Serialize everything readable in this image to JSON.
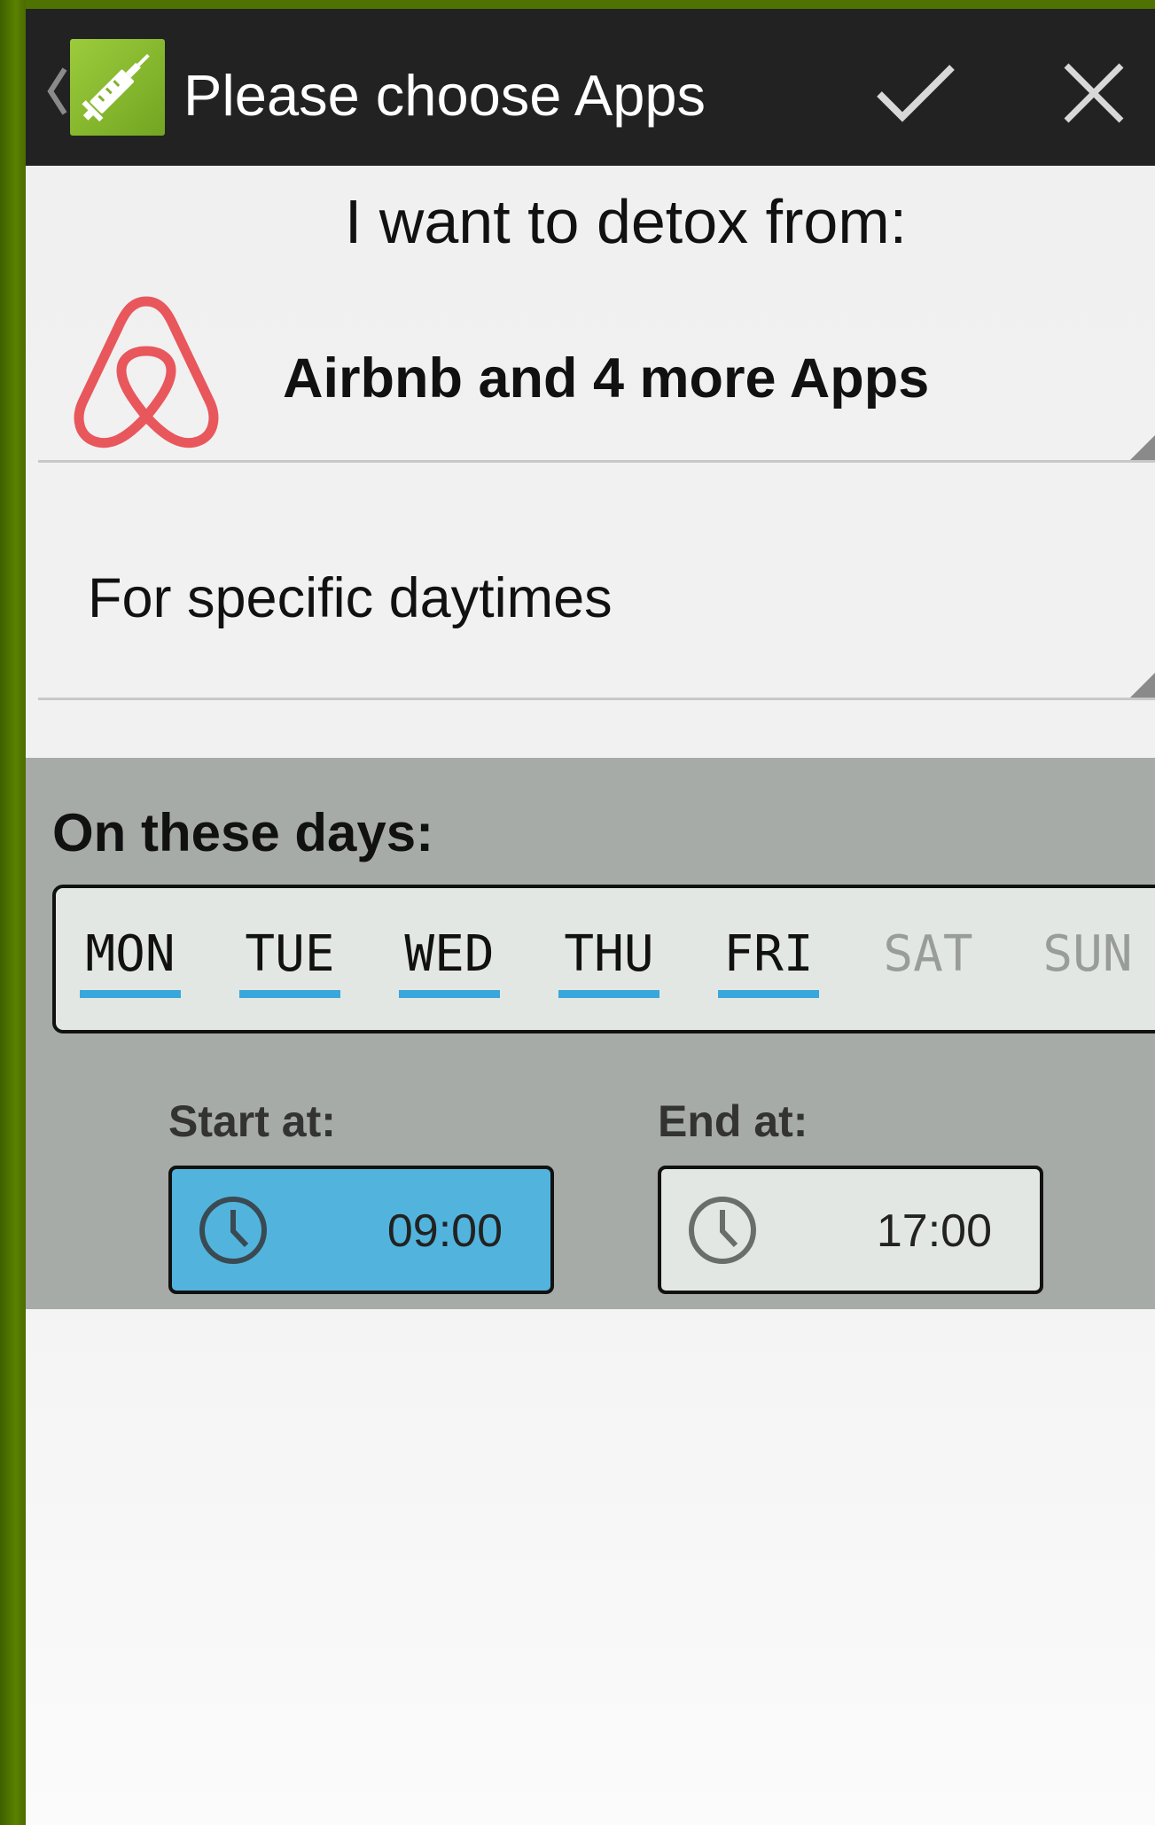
{
  "action_bar": {
    "title": "Please choose Apps",
    "icons": {
      "up": "back-caret-icon",
      "app": "syringe-icon",
      "confirm": "checkmark-icon",
      "cancel": "close-icon"
    }
  },
  "main": {
    "heading": "I want to detox from:",
    "app_selector": {
      "label": "Airbnb and 4 more Apps",
      "icon": "airbnb-logo"
    },
    "mode_selector": {
      "label": "For specific daytimes"
    }
  },
  "schedule": {
    "days_heading": "On these days:",
    "days": [
      {
        "label": "MON",
        "selected": true
      },
      {
        "label": "TUE",
        "selected": true
      },
      {
        "label": "WED",
        "selected": true
      },
      {
        "label": "THU",
        "selected": true
      },
      {
        "label": "FRI",
        "selected": true
      },
      {
        "label": "SAT",
        "selected": false
      },
      {
        "label": "SUN",
        "selected": false
      }
    ],
    "start": {
      "label": "Start at:",
      "value": "09:00",
      "icon": "clock-icon"
    },
    "end": {
      "label": "End at:",
      "value": "17:00",
      "icon": "clock-icon"
    }
  },
  "colors": {
    "frame": "#4e7300",
    "action_bar": "#222222",
    "accent": "#3aa7dc",
    "airbnb": "#e8575c",
    "panel": "#a6aba7",
    "start_button": "#52b4dd"
  }
}
